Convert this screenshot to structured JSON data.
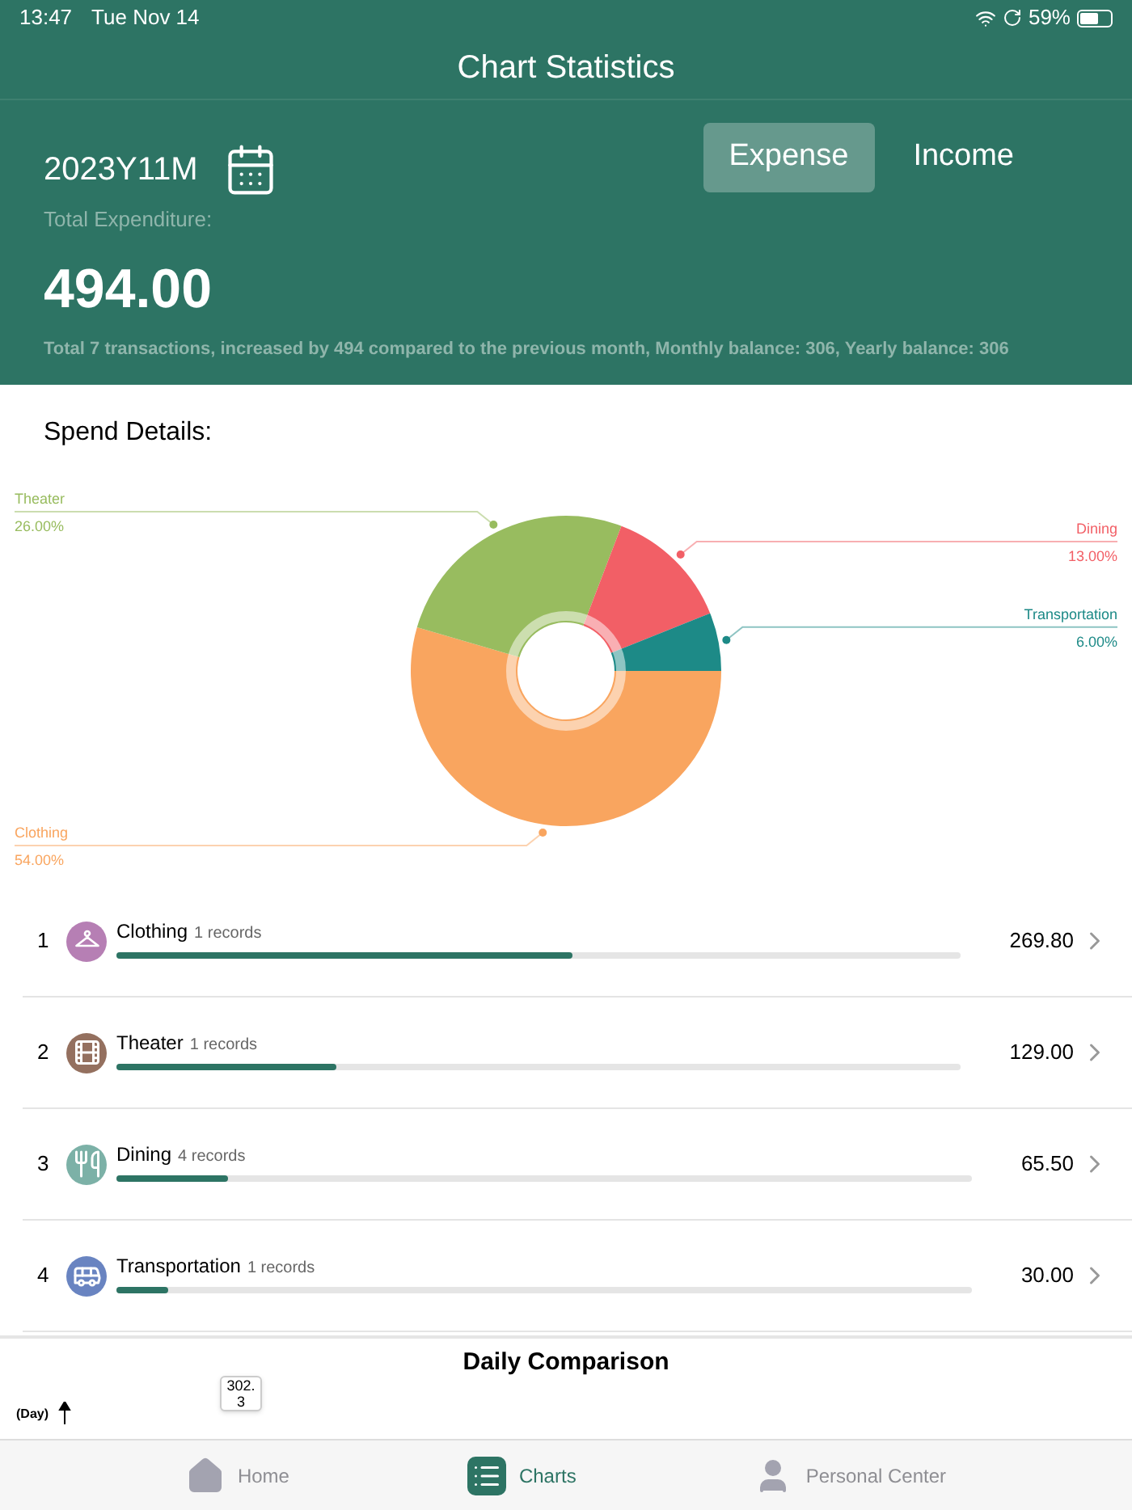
{
  "status_bar": {
    "time": "13:47",
    "date": "Tue Nov 14",
    "battery": "59%"
  },
  "title": "Chart Statistics",
  "summary": {
    "month": "2023Y11M",
    "toggle": [
      {
        "label": "Expense",
        "selected": true
      },
      {
        "label": "Income",
        "selected": false
      }
    ],
    "total_label": "Total Expenditure:",
    "total": "494.00",
    "note": "Total 7 transactions, increased by 494 compared to the previous month, Monthly balance: 306,  Yearly balance: 306"
  },
  "spend_details": {
    "title": "Spend Details:",
    "chart_data": {
      "type": "donut",
      "categories": [
        "Clothing",
        "Theater",
        "Dining",
        "Transportation"
      ],
      "values": [
        54,
        26,
        13,
        6
      ],
      "colors": [
        "#f9a55f",
        "#98bc5f",
        "#f25f66",
        "#1d8a87"
      ],
      "value_labels": [
        "54.00%",
        "26.00%",
        "13.00%",
        "6.00%"
      ]
    }
  },
  "categories": [
    {
      "rank": "1",
      "name": "Clothing",
      "records": "1 records",
      "amount": "269.80",
      "level": 0.54,
      "color": "#b67fb4"
    },
    {
      "rank": "2",
      "name": "Theater",
      "records": "1 records",
      "amount": "129.00",
      "level": 0.26,
      "color": "#94705f"
    },
    {
      "rank": "3",
      "name": "Dining",
      "records": "4 records",
      "amount": "65.50",
      "level": 0.13,
      "color": "#7cb1a7"
    },
    {
      "rank": "4",
      "name": "Transportation",
      "records": "1 records",
      "amount": "30.00",
      "level": 0.06,
      "color": "#6984c1"
    }
  ],
  "daily_comparison": {
    "title": "Daily Comparison",
    "axis_label": "(Day)",
    "tooltip": "302.3"
  },
  "tab_bar": [
    {
      "label": "Home",
      "selected": false
    },
    {
      "label": "Charts",
      "selected": true
    },
    {
      "label": "Personal Center",
      "selected": false
    }
  ]
}
